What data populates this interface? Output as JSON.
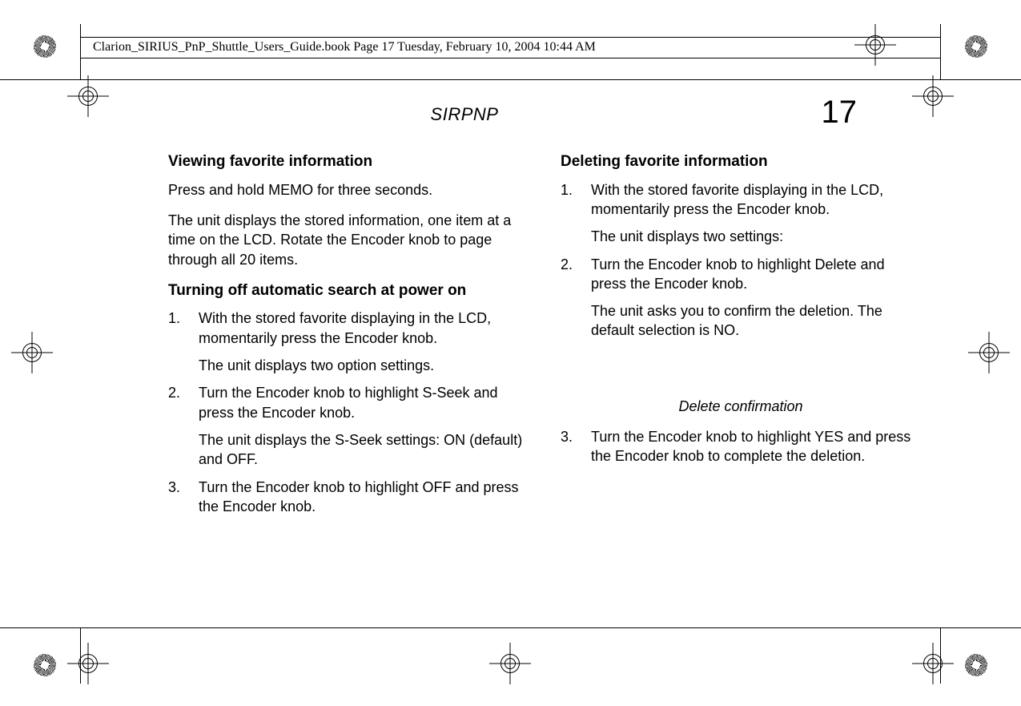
{
  "doc_header": "Clarion_SIRIUS_PnP_Shuttle_Users_Guide.book  Page 17  Tuesday, February 10, 2004  10:44 AM",
  "running_head": "SIRPNP",
  "page_number": "17",
  "left": {
    "h1": "Viewing favorite information",
    "p1": "Press and hold MEMO for three seconds.",
    "p2": "The unit displays the stored information, one item at a time on the LCD. Rotate the Encoder knob to page through all 20 items.",
    "h2": "Turning off automatic search at power on",
    "li1_num": "1.",
    "li1": "With the stored favorite displaying in the LCD, momentarily press the Encoder knob.",
    "li1_sub": "The unit displays two option settings.",
    "li2_num": "2.",
    "li2": "Turn the Encoder knob to highlight S-Seek and press the Encoder knob.",
    "li2_sub": "The unit displays the S-Seek settings: ON (default) and OFF.",
    "li3_num": "3.",
    "li3": "Turn the Encoder knob to highlight OFF and press the Encoder knob."
  },
  "right": {
    "h1": "Deleting favorite information",
    "li1_num": "1.",
    "li1": "With the stored favorite displaying in the LCD, momentarily press the Encoder knob.",
    "li1_sub": "The unit displays two settings:",
    "li2_num": "2.",
    "li2": "Turn the Encoder knob to highlight Delete and press the Encoder knob.",
    "li2_sub": "The unit asks you to confirm the deletion. The default selection is NO.",
    "caption": "Delete confirmation",
    "li3_num": "3.",
    "li3": "Turn the Encoder knob to highlight YES and press the Encoder knob to complete the deletion."
  }
}
